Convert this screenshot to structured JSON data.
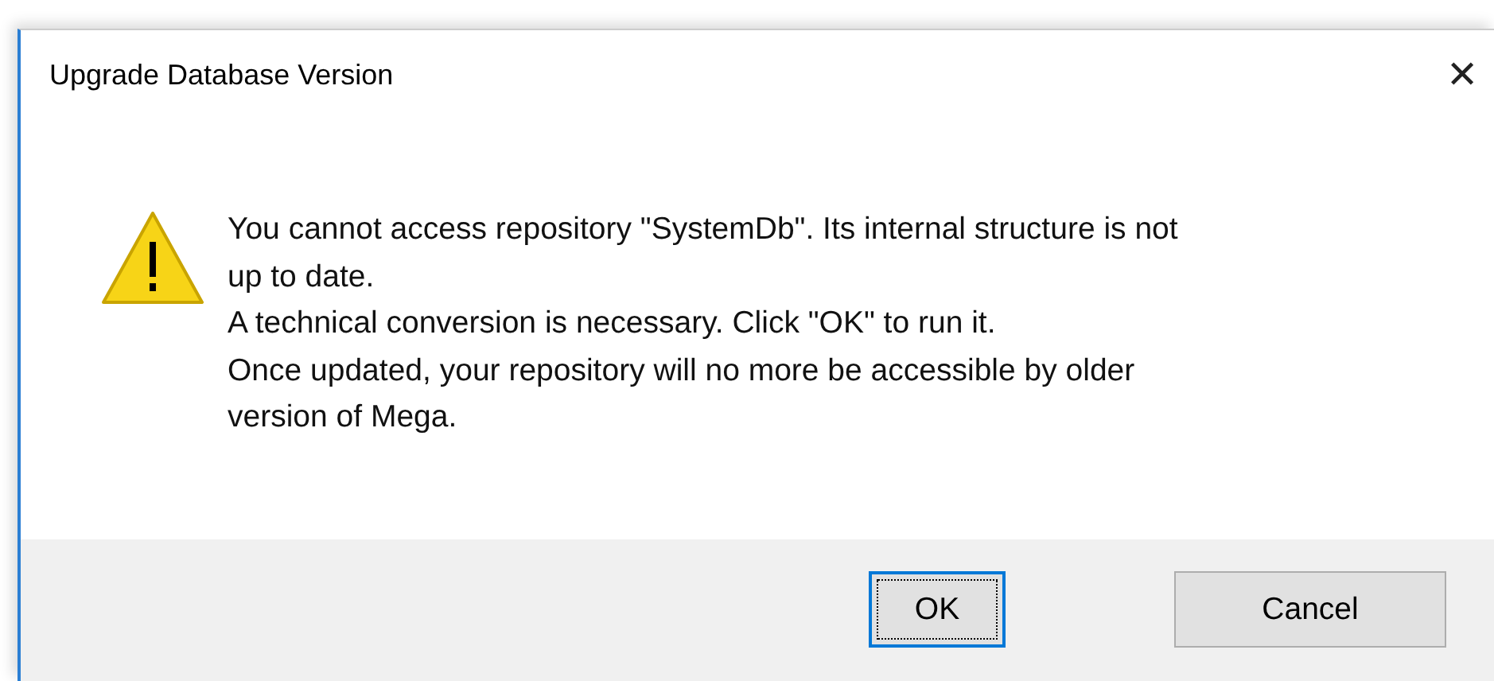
{
  "window": {
    "title": "Upgrade Database Version",
    "close": "✕"
  },
  "message": {
    "lines": [
      "You cannot access repository \"SystemDb\". Its internal structure is not",
      "up to date.",
      "A technical conversion is necessary. Click \"OK\" to run it.",
      "Once updated, your repository will no more be accessible by older",
      "version of Mega."
    ]
  },
  "buttons": [
    {
      "label": "OK",
      "selected": true
    },
    {
      "label": "Cancel",
      "selected": false
    }
  ]
}
